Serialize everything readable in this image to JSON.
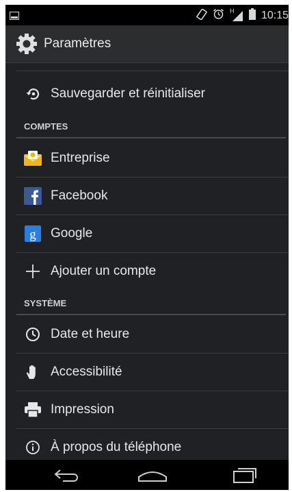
{
  "status_bar": {
    "time": "10:15",
    "network_type": "H",
    "icons": [
      "screenshot-icon",
      "rotation-icon",
      "alarm-icon",
      "signal-icon",
      "battery-icon"
    ]
  },
  "action_bar": {
    "title": "Paramètres",
    "icon": "settings-gear-icon"
  },
  "items": {
    "backup": {
      "label": "Sauvegarder et réinitialiser",
      "icon": "backup-restore-icon"
    },
    "accounts_header": "COMPTES",
    "enterprise": {
      "label": "Entreprise",
      "icon": "enterprise-mail-icon"
    },
    "facebook": {
      "label": "Facebook",
      "icon": "facebook-icon"
    },
    "google": {
      "label": "Google",
      "icon": "google-icon"
    },
    "add_account": {
      "label": "Ajouter un compte",
      "icon": "plus-icon"
    },
    "system_header": "SYSTÈME",
    "date_time": {
      "label": "Date et heure",
      "icon": "clock-icon"
    },
    "accessibility": {
      "label": "Accessibilité",
      "icon": "hand-icon"
    },
    "print": {
      "label": "Impression",
      "icon": "printer-icon"
    },
    "about": {
      "label": "À propos du téléphone",
      "icon": "info-icon"
    }
  },
  "nav_bar": {
    "buttons": [
      "back-icon",
      "home-icon",
      "recent-apps-icon"
    ]
  },
  "colors": {
    "background": "#202124",
    "action_bar": "#2c2d2f",
    "facebook_blue": "#3b5998",
    "google_blue": "#2a7ee0",
    "enterprise_yellow": "#f2b51c"
  }
}
